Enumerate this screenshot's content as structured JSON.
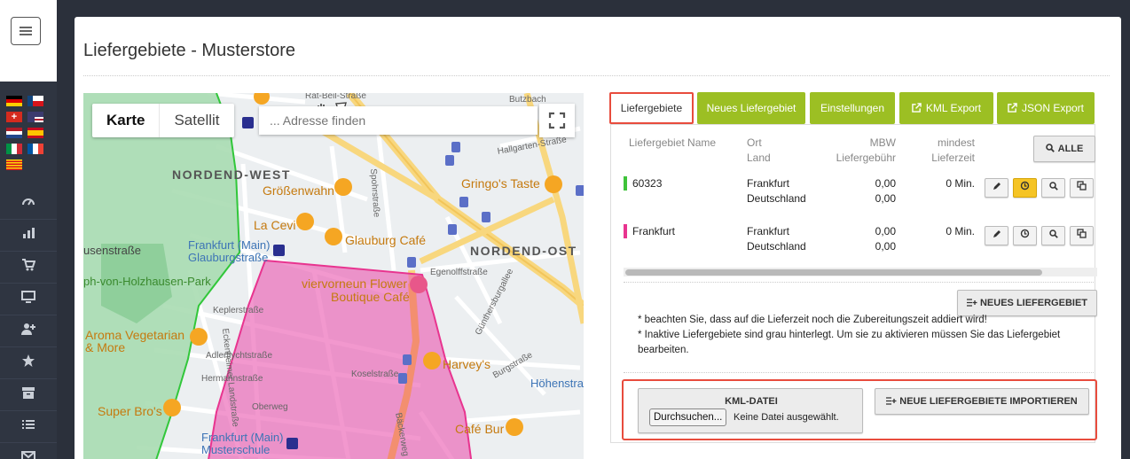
{
  "page": {
    "title": "Liefergebiete - Musterstore"
  },
  "sidebar": {
    "flags": [
      "de",
      "cz",
      "ch",
      "us",
      "nl",
      "es",
      "it",
      "fr",
      "ca"
    ],
    "nav_icons": [
      "dashboard-icon",
      "chart-icon",
      "cart-icon",
      "monitor-icon",
      "add-user-icon",
      "star-icon",
      "archive-icon",
      "list-icon",
      "mail-icon"
    ]
  },
  "map": {
    "type_map": "Karte",
    "type_satellite": "Satellit",
    "search_placeholder": "... Adresse finden",
    "labels": {
      "nordend_west": "NORDEND-WEST",
      "nordend_ost": "NORDEND-OST",
      "groessenwahn": "Größenwahn",
      "gringos": "Gringo's Taste",
      "la_cevi": "La Cevi",
      "glauburg_cafe": "Glauburg Café",
      "station_glauburg_1": "Frankfurt (Main)",
      "station_glauburg_2": "Glauburgstraße",
      "vier_1": "viervorneun Flower",
      "vier_2": "Boutique Café",
      "aroma_1": "Aroma Vegetarian",
      "aroma_2": "& More",
      "harveys": "Harvey's",
      "hoehenstr": "Höhenstra",
      "super_bros": "Super Bro's",
      "cafe_bur": "Café Bur",
      "schule_1": "Frankfurt (Main)",
      "schule_2": "Musterschule",
      "park_1": "ph-von-Holzhausen-Park",
      "park_2": "usenstraße",
      "street_eckenheimer": "Eckenheimer Landstraße",
      "street_keplerstr": "Keplerstraße",
      "street_adlerflycht": "Adlerflychtstraße",
      "street_hermann": "Hermannstraße",
      "street_oberweg": "Oberweg",
      "street_koselstr": "Koselstraße",
      "street_egenolff": "Egenolffstraße",
      "street_guenthersburg": "Günthersburgallee",
      "street_burgstr": "Burgstraße",
      "street_hallgarten": "Hallgarten-Straße",
      "street_sponstr": "Spohrstraße",
      "street_baeckerweg": "Bäckerweg",
      "street_rat_beil": "Rat-Beil-Straße",
      "street_butzbach": "Butzbach"
    }
  },
  "tabs": [
    {
      "label": "Liefergebiete"
    },
    {
      "label": "Neues Liefergebiet"
    },
    {
      "label": "Einstellungen"
    },
    {
      "label": "KML Export"
    },
    {
      "label": "JSON Export"
    }
  ],
  "table": {
    "headers": {
      "name": "Liefergebiet Name",
      "ort": "Ort",
      "land": "Land",
      "mbw": "MBW",
      "fee": "Liefergebühr",
      "min1": "mindest",
      "min2": "Lieferzeit"
    },
    "alle_label": "ALLE",
    "rows": [
      {
        "name": "60323",
        "color": "#3fc33a",
        "ort": "Frankfurt",
        "land": "Deutschland",
        "mbw": "0,00",
        "fee": "0,00",
        "min": "0 Min."
      },
      {
        "name": "Frankfurt",
        "color": "#e8348f",
        "ort": "Frankfurt",
        "land": "Deutschland",
        "mbw": "0,00",
        "fee": "0,00",
        "min": "0 Min."
      }
    ]
  },
  "new_area_button": "NEUES LIEFERGEBIET",
  "notes": [
    "* beachten Sie, dass auf die Lieferzeit noch die Zubereitungszeit addiert wird!",
    "* Inaktive Liefergebiete sind grau hinterlegt. Um sie zu aktivieren müssen Sie das Liefergebiet bearbeiten."
  ],
  "import": {
    "kml_title": "KML-DATEI",
    "browse": "Durchsuchen...",
    "no_file": "Keine Datei ausgewählt.",
    "import_button": "NEUE LIEFERGEBIETE IMPORTIEREN"
  },
  "colors": {
    "tab_green": "#9cbf23",
    "highlight_red": "#e84c3d",
    "history_yellow": "#f5c425"
  }
}
